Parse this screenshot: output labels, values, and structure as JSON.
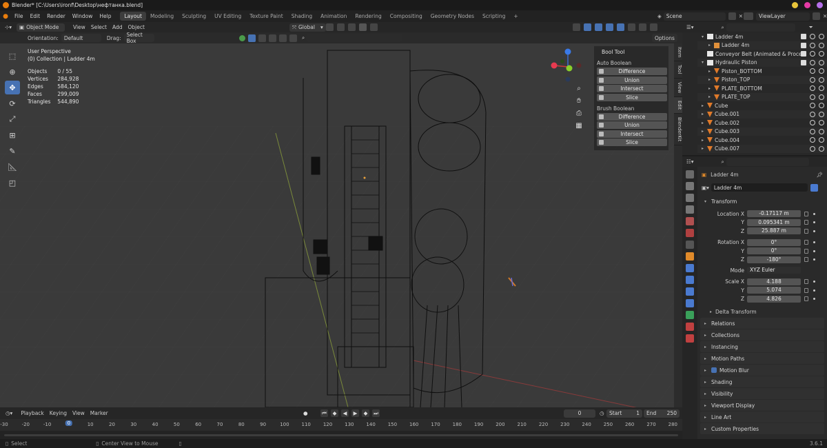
{
  "window": {
    "title": "Blender* [C:\\Users\\ironf\\Desktop\\нефтанка.blend]",
    "colors": {
      "yellow": "#e8c43a",
      "pink": "#e43aa4",
      "purple": "#b46fe8"
    }
  },
  "menu": {
    "items": [
      "File",
      "Edit",
      "Render",
      "Window",
      "Help"
    ],
    "workspaces": [
      "Layout",
      "Modeling",
      "Sculpting",
      "UV Editing",
      "Texture Paint",
      "Shading",
      "Animation",
      "Rendering",
      "Compositing",
      "Geometry Nodes",
      "Scripting"
    ],
    "active_workspace": "Layout",
    "add_tab": "+",
    "scene": "Scene",
    "view_layer": "ViewLayer"
  },
  "viewport_header": {
    "mode": "Object Mode",
    "menus": [
      "View",
      "Select",
      "Add",
      "Object"
    ],
    "transform_orientation": "Global",
    "options": "Options"
  },
  "viewport_tool": {
    "orientation_label": "Orientation:",
    "orientation_value": "Default",
    "drag_label": "Drag:",
    "drag_value": "Select Box"
  },
  "viewport_info": {
    "view": "User Perspective",
    "collection": "(0) Collection | Ladder 4m",
    "stats": [
      {
        "label": "Objects",
        "value": "0 / 55"
      },
      {
        "label": "Vertices",
        "value": "284,928"
      },
      {
        "label": "Edges",
        "value": "584,120"
      },
      {
        "label": "Faces",
        "value": "299,009"
      },
      {
        "label": "Triangles",
        "value": "544,890"
      }
    ]
  },
  "bool_tool": {
    "title": "Bool Tool",
    "auto_label": "Auto Boolean",
    "auto_buttons": [
      "Difference",
      "Union",
      "Intersect",
      "Slice"
    ],
    "brush_label": "Brush Boolean",
    "brush_buttons": [
      "Difference",
      "Union",
      "Intersect",
      "Slice"
    ]
  },
  "sidebar_tabs": [
    "Item",
    "Tool",
    "View",
    "Edit",
    "BlenderKit"
  ],
  "outliner": {
    "rows": [
      {
        "name": "Ladder 4m",
        "indent": 1,
        "expand": "▾",
        "icon": "collection",
        "sel": true
      },
      {
        "name": "Ladder 4m",
        "indent": 2,
        "expand": "▸",
        "icon": "mesh-highlight",
        "sel": true
      },
      {
        "name": "Conveyor Belt (Animated & Proced",
        "indent": 1,
        "expand": "",
        "icon": "collection",
        "sel": true
      },
      {
        "name": "Hydraulic Piston",
        "indent": 1,
        "expand": "▾",
        "icon": "collection",
        "sel": true
      },
      {
        "name": "Piston_BOTTOM",
        "indent": 2,
        "expand": "▸",
        "icon": "mesh",
        "sel": false
      },
      {
        "name": "Piston_TOP",
        "indent": 2,
        "expand": "▸",
        "icon": "mesh",
        "sel": false
      },
      {
        "name": "PLATE_BOTTOM",
        "indent": 2,
        "expand": "▸",
        "icon": "mesh",
        "sel": false
      },
      {
        "name": "PLATE_TOP",
        "indent": 2,
        "expand": "▸",
        "icon": "mesh",
        "sel": false
      },
      {
        "name": "Cube",
        "indent": 1,
        "expand": "▸",
        "icon": "mesh",
        "sel": false
      },
      {
        "name": "Cube.001",
        "indent": 1,
        "expand": "▸",
        "icon": "mesh",
        "sel": false
      },
      {
        "name": "Cube.002",
        "indent": 1,
        "expand": "▸",
        "icon": "mesh",
        "sel": false
      },
      {
        "name": "Cube.003",
        "indent": 1,
        "expand": "▸",
        "icon": "mesh",
        "sel": false
      },
      {
        "name": "Cube.004",
        "indent": 1,
        "expand": "▸",
        "icon": "mesh",
        "sel": false
      },
      {
        "name": "Cube.007",
        "indent": 1,
        "expand": "▸",
        "icon": "mesh",
        "sel": false
      }
    ]
  },
  "properties": {
    "object_name": "Ladder 4m",
    "data_name": "Ladder 4m",
    "transform_title": "Transform",
    "location": {
      "label": "Location X",
      "x": "-0.17117 m",
      "y": "0.095341 m",
      "z": "25.887 m"
    },
    "rotation": {
      "label": "Rotation X",
      "x": "0°",
      "y": "0°",
      "z": "-180°"
    },
    "mode_label": "Mode",
    "mode_value": "XYZ Euler",
    "scale": {
      "label": "Scale X",
      "x": "4.188",
      "y": "5.074",
      "z": "4.826"
    },
    "y_label": "Y",
    "z_label": "Z",
    "delta": "Delta Transform",
    "sections": [
      "Relations",
      "Collections",
      "Instancing",
      "Motion Paths",
      "Motion Blur",
      "Shading",
      "Visibility",
      "Viewport Display",
      "Line Art",
      "Custom Properties"
    ]
  },
  "timeline": {
    "menus": [
      "Playback",
      "Keying",
      "View",
      "Marker"
    ],
    "current_frame": "0",
    "start_label": "Start",
    "start_value": "1",
    "end_label": "End",
    "end_value": "250",
    "ticks": [
      "-30",
      "-20",
      "-10",
      "0",
      "10",
      "20",
      "30",
      "40",
      "50",
      "60",
      "70",
      "80",
      "90",
      "100",
      "110",
      "120",
      "130",
      "140",
      "150",
      "160",
      "170",
      "180",
      "190",
      "200",
      "210",
      "220",
      "230",
      "240",
      "250",
      "260",
      "270",
      "280"
    ]
  },
  "status": {
    "select": "Select",
    "center_view": "Center View to Mouse",
    "version": "3.6.1"
  }
}
